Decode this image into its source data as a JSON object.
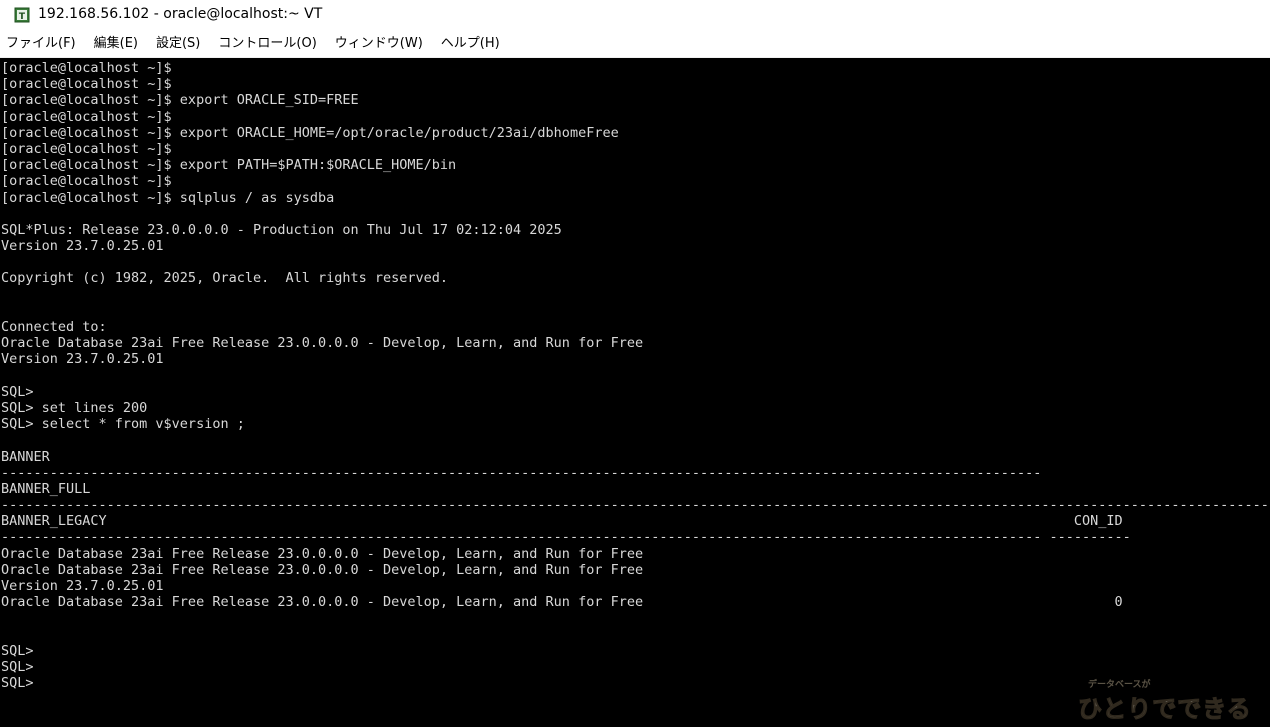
{
  "window": {
    "title": "192.168.56.102 - oracle@localhost:~ VT",
    "icon": "teraterm-app-icon"
  },
  "menu": [
    {
      "label": "ファイル(F)"
    },
    {
      "label": "編集(E)"
    },
    {
      "label": "設定(S)"
    },
    {
      "label": "コントロール(O)"
    },
    {
      "label": "ウィンドウ(W)"
    },
    {
      "label": "ヘルプ(H)"
    }
  ],
  "terminal": {
    "background": "#000000",
    "foreground": "#d8d8d8",
    "lines": [
      "[oracle@localhost ~]$",
      "[oracle@localhost ~]$",
      "[oracle@localhost ~]$ export ORACLE_SID=FREE",
      "[oracle@localhost ~]$",
      "[oracle@localhost ~]$ export ORACLE_HOME=/opt/oracle/product/23ai/dbhomeFree",
      "[oracle@localhost ~]$",
      "[oracle@localhost ~]$ export PATH=$PATH:$ORACLE_HOME/bin",
      "[oracle@localhost ~]$",
      "[oracle@localhost ~]$ sqlplus / as sysdba",
      "",
      "SQL*Plus: Release 23.0.0.0.0 - Production on Thu Jul 17 02:12:04 2025",
      "Version 23.7.0.25.01",
      "",
      "Copyright (c) 1982, 2025, Oracle.  All rights reserved.",
      "",
      "",
      "Connected to:",
      "Oracle Database 23ai Free Release 23.0.0.0.0 - Develop, Learn, and Run for Free",
      "Version 23.7.0.25.01",
      "",
      "SQL>",
      "SQL> set lines 200",
      "SQL> select * from v$version ;",
      "",
      "BANNER",
      "--------------------------------------------------------------------------------------------------------------------------------",
      "BANNER_FULL",
      "--------------------------------------------------------------------------------------------------------------------------------------------------------------------------",
      "BANNER_LEGACY                                                                                                                       CON_ID",
      "-------------------------------------------------------------------------------------------------------------------------------- ----------",
      "Oracle Database 23ai Free Release 23.0.0.0.0 - Develop, Learn, and Run for Free",
      "Oracle Database 23ai Free Release 23.0.0.0.0 - Develop, Learn, and Run for Free",
      "Version 23.7.0.25.01",
      "Oracle Database 23ai Free Release 23.0.0.0.0 - Develop, Learn, and Run for Free                                                          0",
      "",
      "",
      "SQL>",
      "SQL>",
      "SQL>"
    ]
  },
  "watermark": {
    "small_text": "データベースが",
    "big_text": "ひとりでできるもん"
  }
}
